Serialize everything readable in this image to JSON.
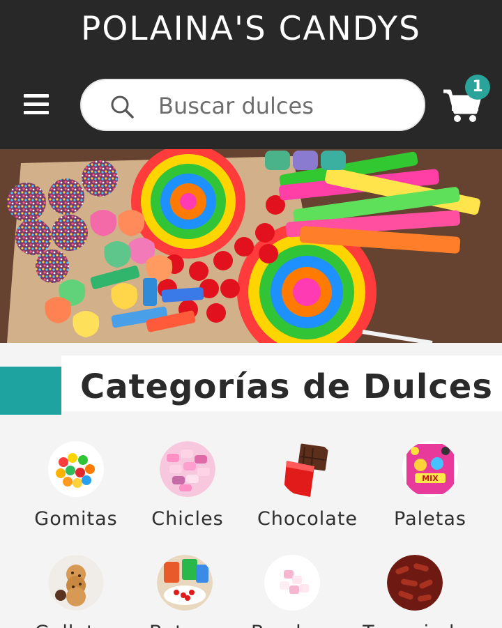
{
  "header": {
    "brand": "POLAINA'S CANDYS",
    "search_placeholder": "Buscar dulces",
    "cart_count": "1"
  },
  "icons": {
    "menu": "hamburger-menu-icon",
    "search": "search-icon",
    "cart": "shopping-cart-icon"
  },
  "colors": {
    "header_bg": "#282828",
    "accent": "#1fa3a0",
    "badge": "#2aa39a",
    "page_bg": "#f4f4f4"
  },
  "section": {
    "title": "Categorías de Dulces"
  },
  "categories": [
    {
      "label": "Gomitas"
    },
    {
      "label": "Chicles"
    },
    {
      "label": "Chocolate"
    },
    {
      "label": "Paletas"
    },
    {
      "label": "Galletas"
    },
    {
      "label": "Botana"
    },
    {
      "label": "Bombon"
    },
    {
      "label": "Tamarindo"
    }
  ]
}
